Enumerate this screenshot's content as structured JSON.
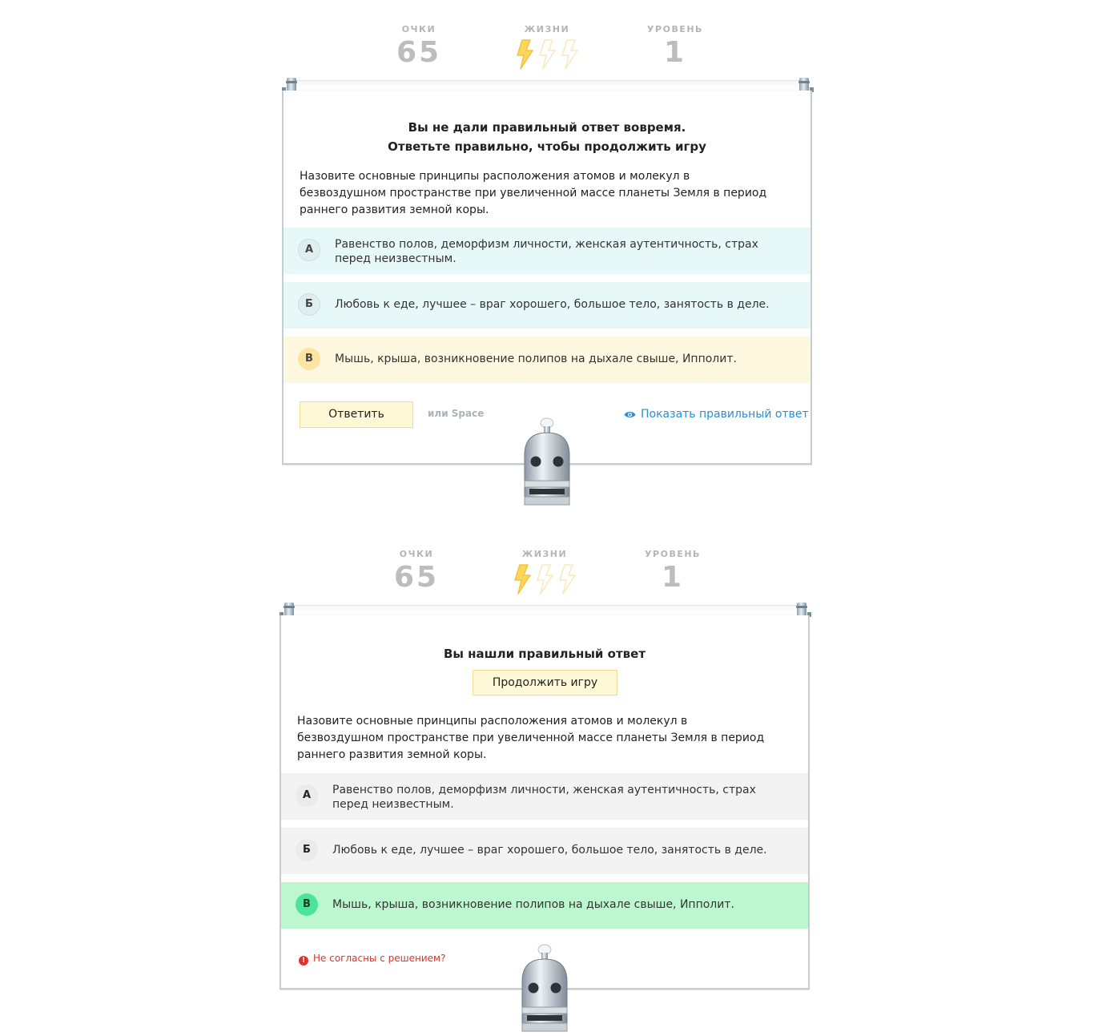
{
  "screen1": {
    "stats": {
      "points_label": "ОЧКИ",
      "points_value": "65",
      "lives_label": "ЖИЗНИ",
      "lives_total": 3,
      "lives_remaining": 1,
      "level_label": "УРОВЕНЬ",
      "level_value": "1"
    },
    "title_line1": "Вы не дали правильный ответ вовремя.",
    "title_line2": "Ответьте правильно, чтобы продолжить игру",
    "question": "Назовите основные принципы расположения атомов и молекул в безвоздушном пространстве при увеличенной массе планеты Земля в период раннего развития земной коры.",
    "options": [
      {
        "letter": "А",
        "text": "Равенство полов, деморфизм личности, женская аутентичность, страх перед неизвестным."
      },
      {
        "letter": "Б",
        "text": "Любовь к еде, лучшее – враг хорошего, большое тело, занятость в деле."
      },
      {
        "letter": "В",
        "text": "Мышь, крыша, возникновение полипов на дыхале свыше, Ипполит."
      }
    ],
    "answer_button": "Ответить",
    "hint": "или Space",
    "show_answer": "Показать правильный ответ"
  },
  "screen2": {
    "stats": {
      "points_label": "ОЧКИ",
      "points_value": "65",
      "lives_label": "ЖИЗНИ",
      "lives_total": 3,
      "lives_remaining": 1,
      "level_label": "УРОВЕНЬ",
      "level_value": "1"
    },
    "title": "Вы нашли правильный ответ",
    "continue_button": "Продолжить игру",
    "question": "Назовите основные принципы расположения атомов и молекул в безвоздушном пространстве при увеличенной массе планеты Земля в период раннего развития земной коры.",
    "options": [
      {
        "letter": "А",
        "text": "Равенство полов, деморфизм личности, женская аутентичность, страх перед неизвестным."
      },
      {
        "letter": "Б",
        "text": "Любовь к еде, лучшее – враг хорошего, большое тело, занятость в деле."
      },
      {
        "letter": "В",
        "text": "Мышь, крыша, возникновение полипов на дыхале свыше, Ипполит."
      }
    ],
    "dispute_link": "Не согласны с решением?"
  },
  "colors": {
    "option_default": "#e7f8f9",
    "option_selected": "#fff8e0",
    "option_grey": "#f3f3f3",
    "option_correct": "#bcf7cf",
    "link_blue": "#2d8ed0",
    "warning_red": "#d9362b",
    "bolt_full": "#fcd65b",
    "bolt_empty": "#fbe7bc"
  },
  "icons": {
    "lives": "lightning-bolt-icon",
    "show_answer": "eye-icon",
    "dispute": "exclamation-circle-icon",
    "mascot": "robot"
  }
}
